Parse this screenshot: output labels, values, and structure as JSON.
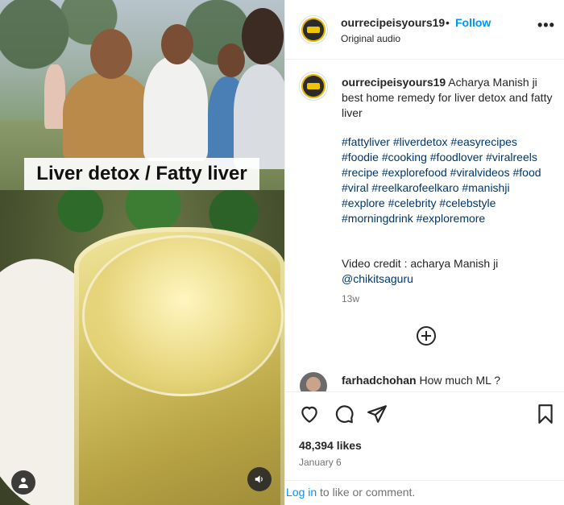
{
  "media": {
    "overlay_text": "Liver detox / Fatty liver"
  },
  "header": {
    "username": "ourrecipeisyours19",
    "separator": "•",
    "follow_label": "Follow",
    "audio_label": "Original audio",
    "more_icon": "more-horizontal-icon"
  },
  "caption": {
    "username": "ourrecipeisyours19",
    "text": "Acharya Manish ji best home remedy for liver detox and fatty liver",
    "hashtags": [
      "#fattyliver",
      "#liverdetox",
      "#easyrecipes",
      "#foodie",
      "#cooking",
      "#foodlover",
      "#viralreels",
      "#recipe",
      "#explorefood",
      "#viralvideos",
      "#food",
      "#viral",
      "#reelkarofeelkaro",
      "#manishji",
      "#explore",
      "#celebrity",
      "#celebstyle",
      "#morningdrink",
      "#exploremore"
    ],
    "credit_text": "Video credit : acharya Manish ji",
    "credit_mention": "@chikitsaguru",
    "time_ago": "13w"
  },
  "comment": {
    "username": "farhadchohan",
    "text": "How much ML ?"
  },
  "actions": {
    "likes": "48,394 likes",
    "date": "January 6"
  },
  "login_bar": {
    "link_label": "Log in",
    "suffix": " to like or comment."
  },
  "colors": {
    "link_blue": "#0095f6",
    "hashtag_blue": "#00376b",
    "secondary_text": "#737373"
  }
}
